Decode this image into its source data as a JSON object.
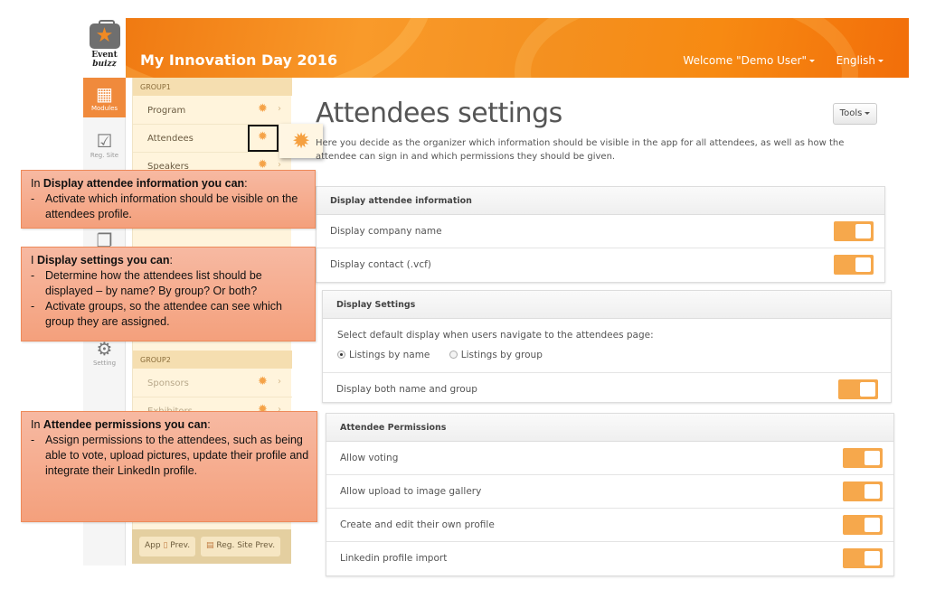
{
  "header": {
    "logo_line1": "Event",
    "logo_line2": "buizz",
    "title": "My Innovation Day 2016",
    "welcome": "Welcome \"Demo User\"",
    "language": "English"
  },
  "leftnav": {
    "items": [
      {
        "label": "Modules",
        "icon": "lego-brick-icon",
        "active": true
      },
      {
        "label": "Reg. Site",
        "icon": "checkbox-icon",
        "active": false
      },
      {
        "label": "",
        "icon": "documents-icon",
        "active": false
      },
      {
        "label": "Setting",
        "icon": "gears-icon",
        "active": false
      }
    ]
  },
  "modules": {
    "groups": [
      {
        "name": "GROUP1",
        "items": [
          "Program",
          "Attendees",
          "Speakers"
        ]
      },
      {
        "name": "GROUP2",
        "items": [
          "Sponsors",
          "Exhibitors"
        ]
      }
    ],
    "preview_buttons": [
      "App",
      "Prev.",
      "Reg. Site Prev."
    ]
  },
  "main": {
    "title": "Attendees settings",
    "tools_label": "Tools",
    "description": "Here you decide as the organizer which information should be visible in the app for all attendees, as well as how the attendee can sign in and which permissions they should be given.",
    "panels": {
      "display_info": {
        "title": "Display attendee information",
        "rows": [
          {
            "label": "Display company name",
            "on": true
          },
          {
            "label": "Display contact (.vcf)",
            "on": true
          }
        ]
      },
      "display_settings": {
        "title": "Display Settings",
        "prompt": "Select default display when users navigate to the attendees page:",
        "options": [
          {
            "label": "Listings by name",
            "selected": true
          },
          {
            "label": "Listings by group",
            "selected": false
          }
        ],
        "rows": [
          {
            "label": "Display both name and group",
            "on": true
          }
        ]
      },
      "permissions": {
        "title": "Attendee Permissions",
        "rows": [
          {
            "label": "Allow voting",
            "on": true
          },
          {
            "label": "Allow upload to image gallery",
            "on": true
          },
          {
            "label": "Create and edit their own profile",
            "on": true
          },
          {
            "label": "Linkedin profile import",
            "on": true
          }
        ]
      }
    }
  },
  "callouts": [
    {
      "prefix": "In ",
      "bold": "Display attendee information you can",
      "suffix": ":",
      "bullets": [
        "Activate which information should be visible on the attendees profile."
      ]
    },
    {
      "prefix": "I ",
      "bold": "Display settings you can",
      "suffix": ":",
      "bullets": [
        "Determine how the attendees list should be displayed – by name? By group? Or both?",
        "Activate groups, so the attendee can see which group they are assigned."
      ]
    },
    {
      "prefix": "In ",
      "bold": "Attendee permissions you can",
      "suffix": ":",
      "bullets": [
        "Assign permissions to the attendees, such as being able to vote, upload pictures, update their profile and integrate their LinkedIn profile."
      ]
    }
  ],
  "colors": {
    "brand_orange": "#f08a24",
    "toggle_on": "#f6a84c",
    "callout_bg": "#f4a07c"
  }
}
